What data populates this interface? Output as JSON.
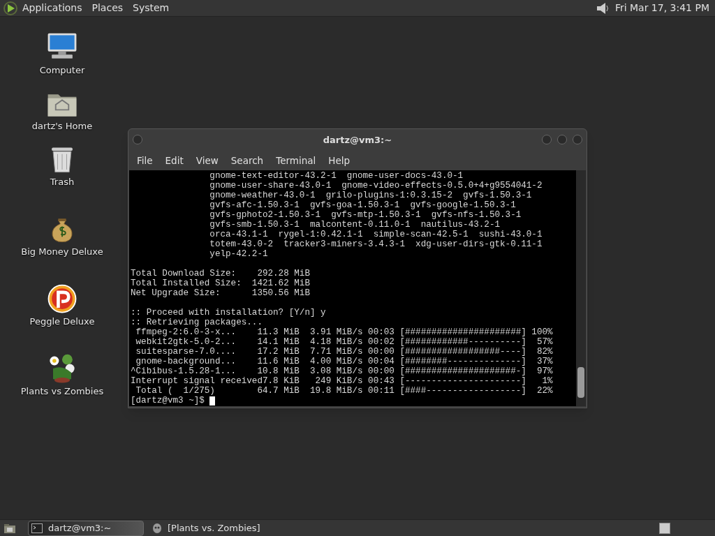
{
  "top_panel": {
    "menus": [
      "Applications",
      "Places",
      "System"
    ],
    "clock": "Fri Mar 17, 3:41 PM"
  },
  "desktop_icons": [
    {
      "kind": "computer",
      "label": "Computer"
    },
    {
      "kind": "home",
      "label": "dartz's Home"
    },
    {
      "kind": "trash",
      "label": "Trash"
    },
    {
      "kind": "money",
      "label": "Big Money Deluxe"
    },
    {
      "kind": "peggle",
      "label": "Peggle Deluxe"
    },
    {
      "kind": "plants",
      "label": "Plants vs Zombies"
    }
  ],
  "terminal": {
    "title": "dartz@vm3:~",
    "menu": [
      "File",
      "Edit",
      "View",
      "Search",
      "Terminal",
      "Help"
    ],
    "blocks": [
      [
        "               gnome-text-editor-43.2-1  gnome-user-docs-43.0-1",
        "               gnome-user-share-43.0-1  gnome-video-effects-0.5.0+4+g9554041-2",
        "               gnome-weather-43.0-1  grilo-plugins-1:0.3.15-2  gvfs-1.50.3-1",
        "               gvfs-afc-1.50.3-1  gvfs-goa-1.50.3-1  gvfs-google-1.50.3-1",
        "               gvfs-gphoto2-1.50.3-1  gvfs-mtp-1.50.3-1  gvfs-nfs-1.50.3-1",
        "               gvfs-smb-1.50.3-1  malcontent-0.11.0-1  nautilus-43.2-1",
        "               orca-43.1-1  rygel-1:0.42.1-1  simple-scan-42.5-1  sushi-43.0-1",
        "               totem-43.0-2  tracker3-miners-3.4.3-1  xdg-user-dirs-gtk-0.11-1",
        "               yelp-42.2-1"
      ],
      [
        "Total Download Size:    292.28 MiB",
        "Total Installed Size:  1421.62 MiB",
        "Net Upgrade Size:      1350.56 MiB"
      ],
      [
        ":: Proceed with installation? [Y/n] y",
        ":: Retrieving packages...",
        " ffmpeg-2:6.0-3-x...    11.3 MiB  3.91 MiB/s 00:03 [######################] 100%",
        " webkit2gtk-5.0-2...    14.1 MiB  4.18 MiB/s 00:02 [############----------]  57%",
        " suitesparse-7.0....    17.2 MiB  7.71 MiB/s 00:00 [##################----]  82%",
        " gnome-background...    11.6 MiB  4.00 MiB/s 00:04 [########--------------]  37%",
        "^Cibibus-1.5.28-1...    10.8 MiB  3.08 MiB/s 00:00 [#####################-]  97%",
        "Interrupt signal received7.8 KiB   249 KiB/s 00:43 [----------------------]   1%",
        " Total (  1/275)        64.7 MiB  19.8 MiB/s 00:11 [####------------------]  22%"
      ]
    ],
    "prompt": "[dartz@vm3 ~]$ "
  },
  "taskbar": {
    "tasks": [
      {
        "kind": "terminal",
        "label": "dartz@vm3:~",
        "selected": true
      },
      {
        "kind": "game",
        "label": "[Plants vs. Zombies]",
        "selected": false
      }
    ]
  }
}
